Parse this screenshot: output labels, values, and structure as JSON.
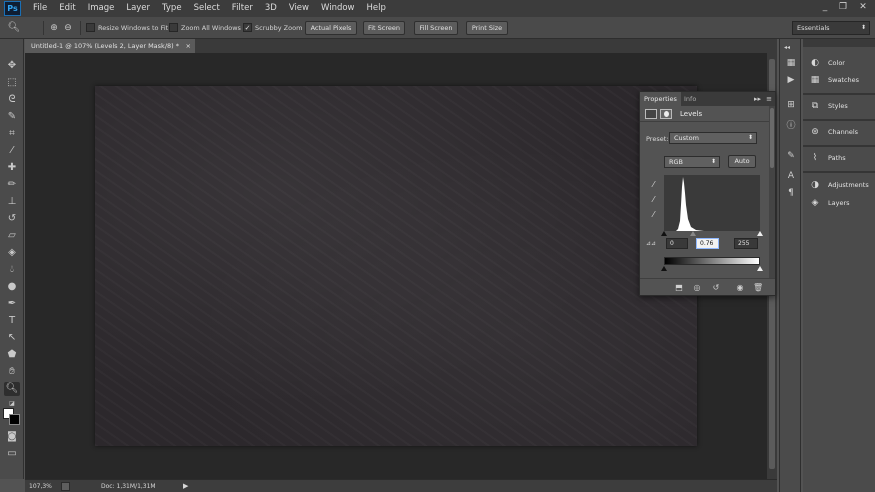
{
  "menubar": {
    "logo": "Ps",
    "items": [
      "File",
      "Edit",
      "Image",
      "Layer",
      "Type",
      "Select",
      "Filter",
      "3D",
      "View",
      "Window",
      "Help"
    ],
    "window_controls": {
      "minimize": "_",
      "restore": "❐",
      "close": "✕"
    }
  },
  "options": {
    "zoom_tool_icon": "zoom-in-icon",
    "resize_windows": {
      "label": "Resize Windows to Fit",
      "checked": false
    },
    "zoom_all": {
      "label": "Zoom All Windows",
      "checked": false
    },
    "scrubby": {
      "label": "Scrubby Zoom",
      "checked": true,
      "mark": "✓"
    },
    "buttons": [
      "Actual Pixels",
      "Fit Screen",
      "Fill Screen",
      "Print Size"
    ],
    "workspace": "Essentials"
  },
  "document": {
    "tab_label": "Untitled-1 @ 107% (Levels 2, Layer Mask/8) *",
    "close_label": "×"
  },
  "status": {
    "zoom": "107,3%",
    "doc_info": "Doc: 1,31M/1,31M",
    "arrow": "▶"
  },
  "properties": {
    "tabs": [
      "Properties",
      "Info"
    ],
    "collapse": "▸▸",
    "menu": "≡",
    "title": "Levels",
    "preset_label": "Preset:",
    "preset_value": "Custom",
    "channel_value": "RGB",
    "auto_label": "Auto",
    "input_black": "0",
    "input_mid": "0.76",
    "input_white": "255",
    "clip_icon_label": "⊿⊿"
  },
  "dock": {
    "items": [
      {
        "icon": "color-icon",
        "label": "Color"
      },
      {
        "icon": "swatches-icon",
        "label": "Swatches"
      },
      {
        "icon": "styles-icon",
        "label": "Styles"
      },
      {
        "icon": "channels-icon",
        "label": "Channels"
      },
      {
        "icon": "paths-icon",
        "label": "Paths"
      },
      {
        "icon": "adjustments-icon",
        "label": "Adjustments"
      },
      {
        "icon": "layers-icon",
        "label": "Layers"
      }
    ]
  }
}
